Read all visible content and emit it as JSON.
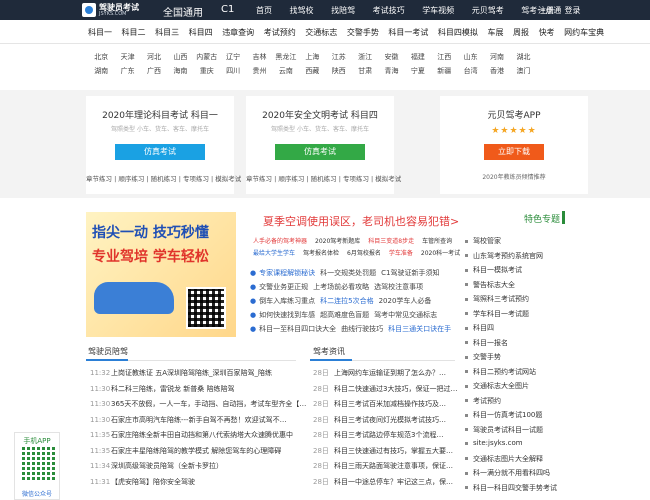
{
  "header": {
    "logo_text": "驾驶员考试",
    "logo_domain": "JSYKS.COM",
    "region": "全国通用",
    "license": "C1",
    "nav": [
      "首页",
      "找驾校",
      "找陪驾",
      "考试技巧",
      "学车视频",
      "元贝驾考",
      "驾考一点通"
    ],
    "login_register": [
      "注册",
      "登录"
    ]
  },
  "subject_nav": [
    "科目一",
    "科目二",
    "科目三",
    "科目四",
    "违章查询",
    "考试预约",
    "交通标志",
    "交警手势",
    "科目一考试",
    "科目四模拟",
    "车展",
    "周报",
    "快考",
    "网约车宝典"
  ],
  "provinces": [
    [
      "北京",
      "天津",
      "河北",
      "山西",
      "内蒙古",
      "辽宁",
      "吉林",
      "黑龙江",
      "上海",
      "江苏",
      "浙江",
      "安徽",
      "福建",
      "江西",
      "山东",
      "河南",
      "湖北"
    ],
    [
      "湖南",
      "广东",
      "广西",
      "海南",
      "重庆",
      "四川",
      "贵州",
      "云南",
      "西藏",
      "陕西",
      "甘肃",
      "青海",
      "宁夏",
      "新疆",
      "台湾",
      "香港",
      "澳门"
    ]
  ],
  "cards": [
    {
      "title": "2020年理论科目考试 科目一",
      "subtitle": "驾照类型 小车、货车、客车、摩托车",
      "button": "仿真考试",
      "button_color": "#1aa1e3",
      "links": "章节练习 | 顺序练习 | 随机练习 | 专项练习 | 模拟考试"
    },
    {
      "title": "2020年安全文明考试 科目四",
      "subtitle": "驾照类型 小车、货车、客车、摩托车",
      "button": "仿真考试",
      "button_color": "#33a946",
      "links": "章节练习 | 顺序练习 | 随机练习 | 专项练习 | 模拟考试"
    },
    {
      "title": "元贝驾考APP",
      "stars": "★★★★★",
      "button": "立即下载",
      "button_color": "#f05a1a",
      "note": "2020年教练员倾情推荐"
    }
  ],
  "banner": {
    "line1": "指尖一动 技巧秒懂",
    "line2": "专业驾培 学车轻松"
  },
  "headline": "夏季空调使用误区，老司机也容易犯错>",
  "taglines": [
    [
      {
        "t": "人手必备的驾考神器",
        "c": "red"
      },
      {
        "t": "2020驾考新题库",
        "c": ""
      },
      {
        "t": "科目三变道8步走",
        "c": "red"
      },
      {
        "t": "车管所查询",
        "c": ""
      }
    ],
    [
      {
        "t": "最给大学生学车",
        "c": "blue"
      },
      {
        "t": "驾考报名体检",
        "c": ""
      },
      {
        "t": "6月驾校报名",
        "c": ""
      },
      {
        "t": "学车准备",
        "c": "red"
      },
      {
        "t": "2020科一考试",
        "c": ""
      }
    ]
  ],
  "news": [
    [
      {
        "t": "专家课程解锁秘诀",
        "c": "blue"
      },
      {
        "t": "科一交规类处罚题",
        "c": ""
      },
      {
        "t": "C1驾驶证新手须知",
        "c": ""
      }
    ],
    [
      {
        "t": "交警业务更正规",
        "c": ""
      },
      {
        "t": "上考场前必看攻略",
        "c": ""
      },
      {
        "t": "选驾校注意事项",
        "c": ""
      }
    ],
    [
      {
        "t": "倒车入库练习重点",
        "c": ""
      },
      {
        "t": "科二连拉5次合格",
        "c": "blue"
      },
      {
        "t": "2020学车人必备",
        "c": ""
      }
    ],
    [
      {
        "t": "如何快速找到车感",
        "c": ""
      },
      {
        "t": "超高难度色盲题",
        "c": ""
      },
      {
        "t": "驾考中常见交通标志",
        "c": ""
      }
    ],
    [
      {
        "t": "科目一至科目四口诀大全",
        "c": ""
      },
      {
        "t": "曲线行驶技巧",
        "c": ""
      },
      {
        "t": "科目三通关口诀在手",
        "c": "blue"
      }
    ]
  ],
  "featured": {
    "title": "特色专题",
    "items": [
      "驾校管家",
      "山东驾考预约系统官网",
      "科目一模拟考试",
      "警告标志大全",
      "驾照科三考试预约",
      "学车科目一考试题",
      "科目四",
      "科目一报名",
      "交警手势",
      "科目二预约考试网站",
      "交通标志大全图片",
      "考试预约",
      "科目一仿真考试100题",
      "驾驶员考试科目一试题",
      "site:jsyks.com",
      "交通标志图片大全解释",
      "科一满分就不用看科四吗",
      "科目一科目四交警手势考试"
    ]
  },
  "columns": [
    {
      "title": "驾驶员陪驾",
      "items": [
        {
          "d": "11:32",
          "t": "上岗证教练证 五A深圳陪驾陪练_深圳百家陪驾_陪练"
        },
        {
          "d": "11:30",
          "t": "科二科三陪练，雷锐龙 新普桑 陪练陪驾"
        },
        {
          "d": "11:30",
          "t": "365天不放假，一人一车，手动挡、自动挡，考试车型齐全【…"
        },
        {
          "d": "11:30",
          "t": "石家庄市高明汽车陪练---新手自驾不再愁！欢迎试驾不…"
        },
        {
          "d": "11:35",
          "t": "石家庄陪练全新丰田自动挡和第八代索纳塔大众速腾优惠中"
        },
        {
          "d": "11:35",
          "t": "石家庄丰星陪练陪驾的教学模式 解除您驾车的心理障碍"
        },
        {
          "d": "11:34",
          "t": "深圳高级驾驶员陪驾（全新卡罗拉）"
        },
        {
          "d": "11:31",
          "t": "【虎安陪驾】陪你安全驾驶"
        }
      ]
    },
    {
      "title": "驾考资讯",
      "items": [
        {
          "d": "28日",
          "t": "上海网约车运输证到期了怎么办？…"
        },
        {
          "d": "28日",
          "t": "科目二快速通过3大技巧，保证一把过…"
        },
        {
          "d": "28日",
          "t": "科目三考试百米加减档操作技巧及…"
        },
        {
          "d": "28日",
          "t": "科目三考试夜间灯光模拟考试技巧…"
        },
        {
          "d": "28日",
          "t": "科目三考试路边停车规范3个流程…"
        },
        {
          "d": "28日",
          "t": "科目三快速通过有技巧，掌握五大要…"
        },
        {
          "d": "28日",
          "t": "科目三雨天路面驾驶注意事项，保证…"
        },
        {
          "d": "28日",
          "t": "科目一中途总停车？牢记这三点，保…"
        }
      ]
    }
  ],
  "side_app": {
    "title": "手机APP",
    "bottom": "微信公众号"
  }
}
